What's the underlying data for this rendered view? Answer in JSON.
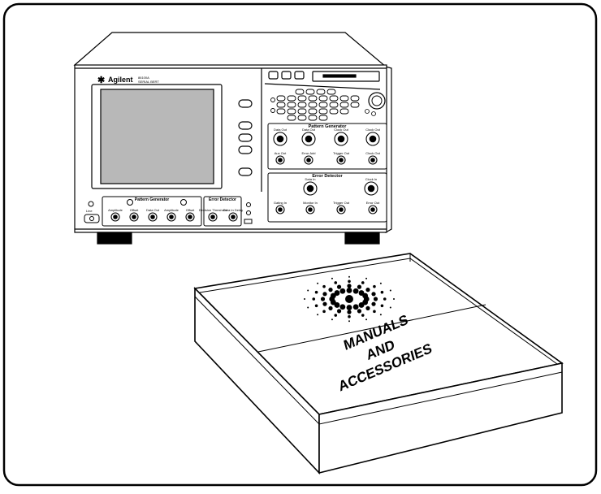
{
  "figure": {
    "brand": "Agilent",
    "model_line": "86100A",
    "model_subline": "SERIAL BERT",
    "front_panel": {
      "pattern_generator_title": "Pattern Generator",
      "error_detector_title": "Error Detector",
      "pg_row1": [
        "Data Out",
        "Data Out",
        "Clock Out",
        "Clock Out"
      ],
      "pg_row2": [
        "Aux Out",
        "Error Add",
        "Trigger Out",
        "Clock Out"
      ],
      "ed_row1": [
        "Data In",
        "Clock In"
      ],
      "ed_row2": [
        "Gating In",
        "Monitor In",
        "Trigger Out",
        "Error Out"
      ],
      "lower_pg_items": [
        "Amplitude",
        "Offset",
        "Data Out",
        "Amplitude",
        "Offset"
      ],
      "lower_ed_items": [
        "Decision Threshold",
        "Data In Delay"
      ],
      "left_labels": [
        "Line"
      ]
    },
    "box_label_lines": [
      "MANUALS",
      "AND",
      "ACCESSORIES"
    ]
  }
}
